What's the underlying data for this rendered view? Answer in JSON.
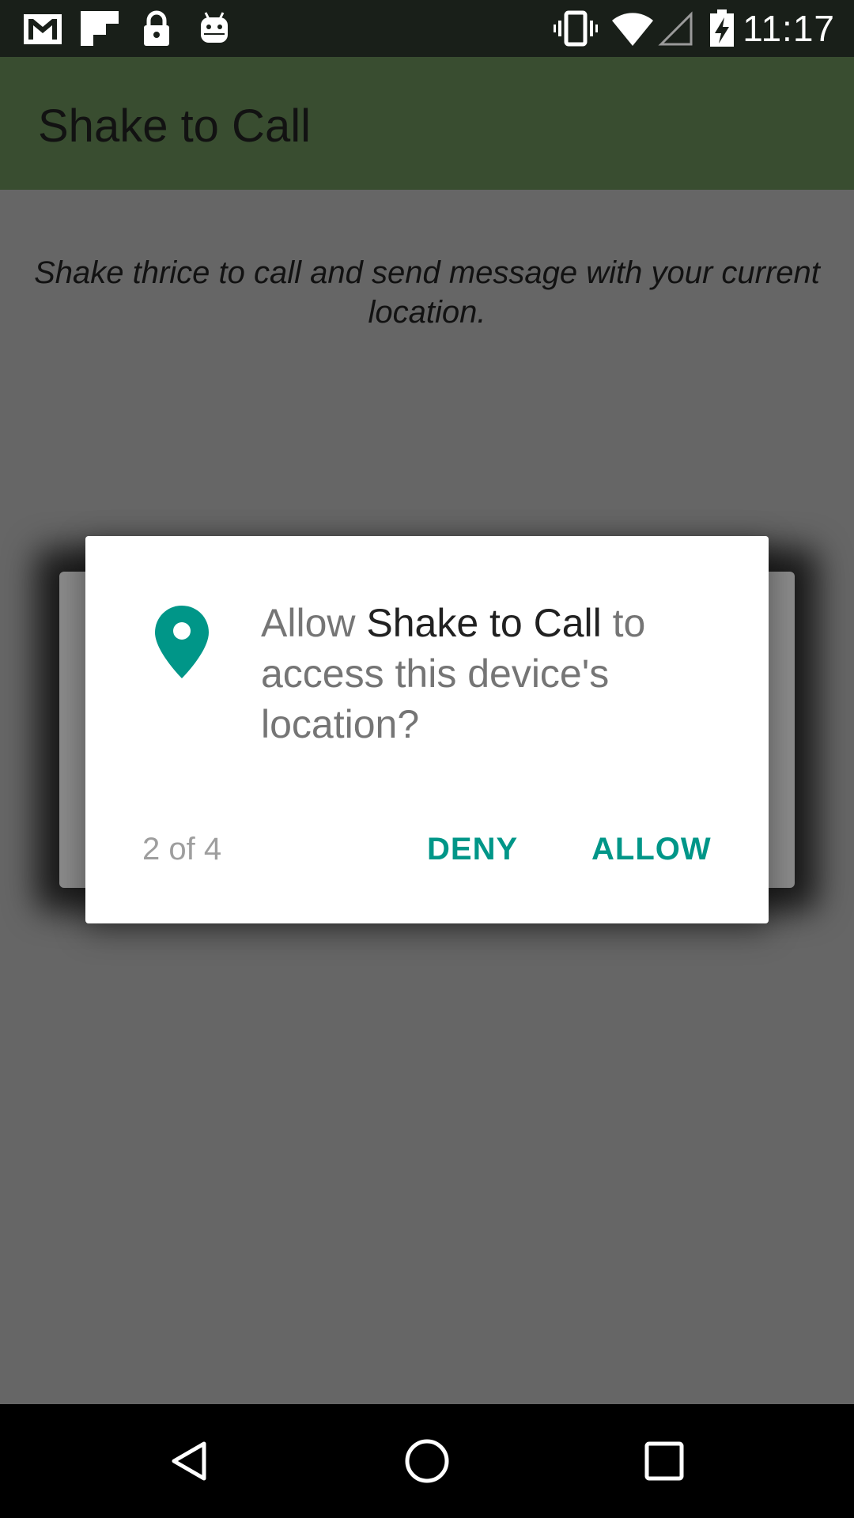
{
  "status_bar": {
    "time": "11:17",
    "icons": [
      "gmail-icon",
      "flipboard-icon",
      "lock-icon",
      "android-icon",
      "vibrate-icon",
      "wifi-icon",
      "cellular-signal-icon",
      "battery-charging-icon"
    ]
  },
  "app_bar": {
    "title": "Shake to Call"
  },
  "main": {
    "instruction": "Shake thrice to call and send message with your current location."
  },
  "dialog": {
    "icon": "location-pin-icon",
    "message_prefix": "Allow ",
    "app_name": "Shake to Call",
    "message_suffix": " to access this device's location?",
    "counter": "2 of 4",
    "deny_label": "DENY",
    "allow_label": "ALLOW"
  },
  "nav_bar": {
    "icons": [
      "back-icon",
      "home-icon",
      "recent-apps-icon"
    ]
  },
  "colors": {
    "status_bar": "#191f19",
    "app_bar": "#394d30",
    "scrim": "#666666",
    "accent": "#009688"
  }
}
